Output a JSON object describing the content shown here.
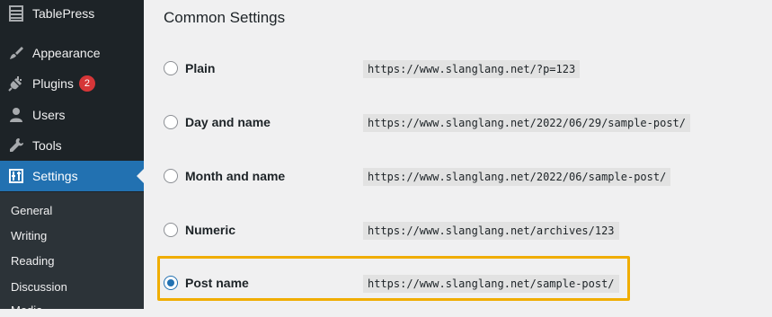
{
  "sidebar": {
    "items": [
      {
        "label": "TablePress",
        "icon": "table-icon"
      },
      {
        "label": "Appearance",
        "icon": "paintbrush-icon"
      },
      {
        "label": "Plugins",
        "icon": "plug-icon",
        "badge": "2"
      },
      {
        "label": "Users",
        "icon": "users-icon"
      },
      {
        "label": "Tools",
        "icon": "wrench-icon"
      },
      {
        "label": "Settings",
        "icon": "settings-icon",
        "active": true
      }
    ],
    "submenu": [
      "General",
      "Writing",
      "Reading",
      "Discussion",
      "Media"
    ]
  },
  "main": {
    "section_title": "Common Settings",
    "options": [
      {
        "label": "Plain",
        "example": "https://www.slanglang.net/?p=123",
        "checked": false
      },
      {
        "label": "Day and name",
        "example": "https://www.slanglang.net/2022/06/29/sample-post/",
        "checked": false
      },
      {
        "label": "Month and name",
        "example": "https://www.slanglang.net/2022/06/sample-post/",
        "checked": false
      },
      {
        "label": "Numeric",
        "example": "https://www.slanglang.net/archives/123",
        "checked": false
      },
      {
        "label": "Post name",
        "example": "https://www.slanglang.net/sample-post/",
        "checked": true
      }
    ]
  },
  "colors": {
    "sidebar_bg": "#1d2327",
    "active": "#2271b1",
    "highlight_border": "#f0ad00",
    "badge": "#d63638"
  }
}
